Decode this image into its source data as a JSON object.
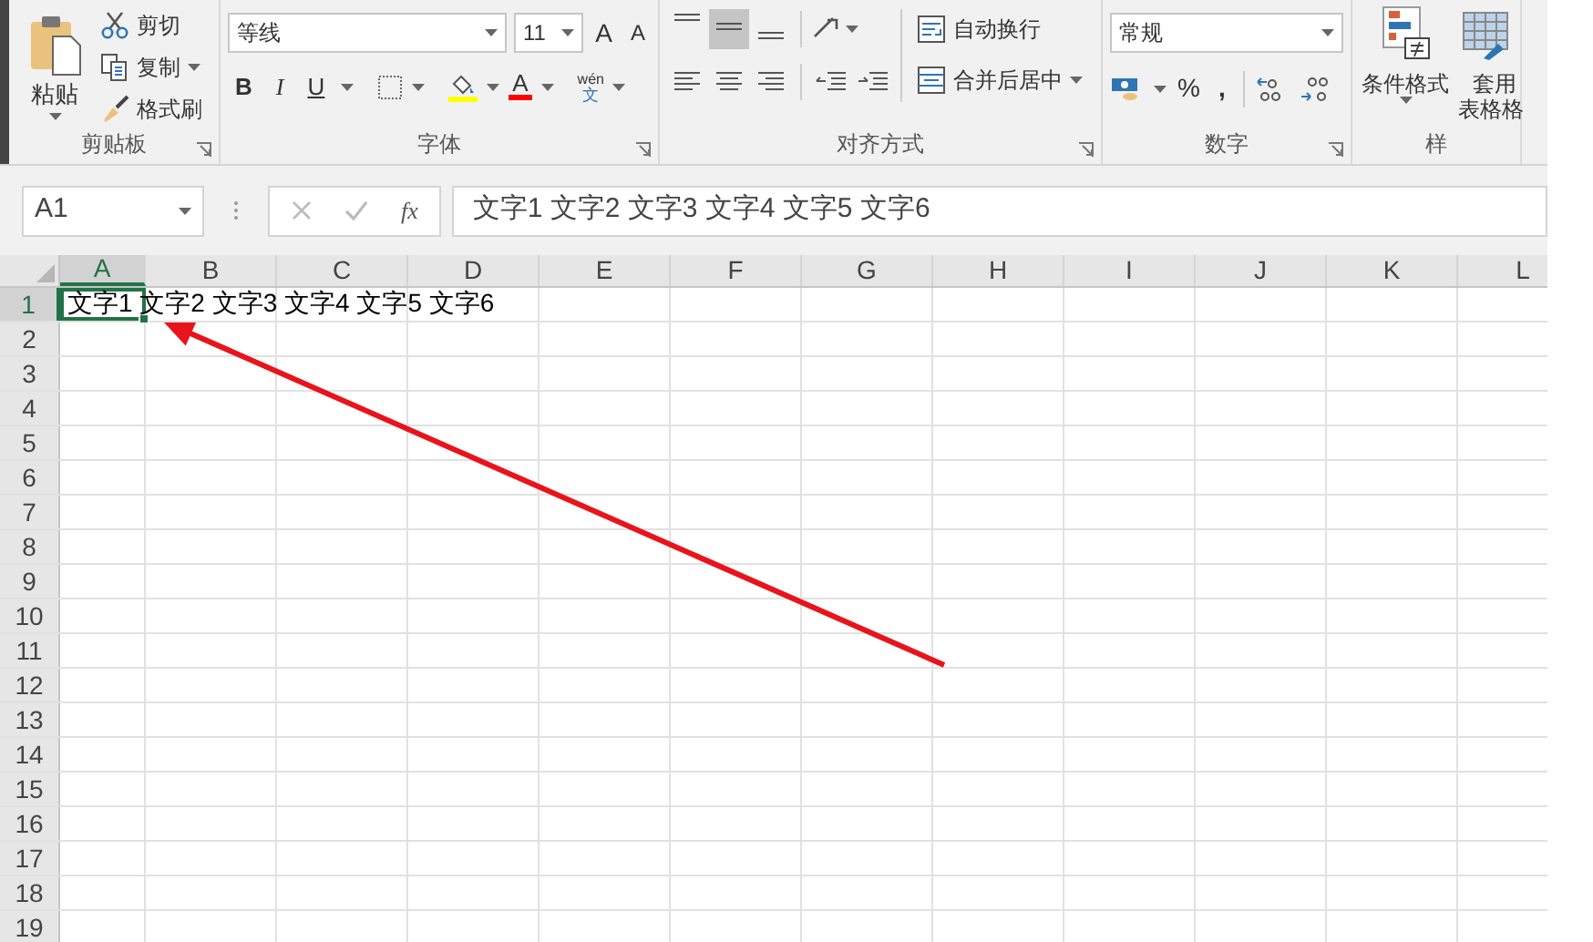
{
  "ribbon": {
    "groups": [
      {
        "kind": "clipboard",
        "label": "剪贴板",
        "paste": "粘贴",
        "cut": "剪切",
        "copy": "复制",
        "format_painter": "格式刷"
      },
      {
        "kind": "font",
        "label": "字体",
        "font_name": "等线",
        "font_size": "11",
        "grow_font": "A",
        "shrink_font": "A",
        "bold": "B",
        "italic": "I",
        "underline": "U",
        "font_color": "A",
        "phonetic_top": "wén",
        "phonetic_bottom": "文"
      },
      {
        "kind": "alignment",
        "label": "对齐方式",
        "wrap_text": "自动换行",
        "merge_center": "合并后居中",
        "vertical_align": [
          {
            "selected": false
          },
          {
            "selected": true
          },
          {
            "selected": false
          }
        ]
      },
      {
        "kind": "number",
        "label": "数字",
        "format": "常规",
        "percent": "%",
        "comma": ","
      },
      {
        "kind": "styles",
        "label": "样",
        "conditional_format": "条件格式",
        "table_format_line1": "套用",
        "table_format_line2": "表格格"
      }
    ]
  },
  "formula_bar": {
    "name_box": "A1",
    "fx": "fx",
    "formula": "文字1 文字2 文字3 文字4 文字5 文字6"
  },
  "sheet": {
    "columns": [
      {
        "label": "A",
        "selected": true
      },
      {
        "label": "B",
        "selected": false
      },
      {
        "label": "C",
        "selected": false
      },
      {
        "label": "D",
        "selected": false
      },
      {
        "label": "E",
        "selected": false
      },
      {
        "label": "F",
        "selected": false
      },
      {
        "label": "G",
        "selected": false
      },
      {
        "label": "H",
        "selected": false
      },
      {
        "label": "I",
        "selected": false
      },
      {
        "label": "J",
        "selected": false
      },
      {
        "label": "K",
        "selected": false
      },
      {
        "label": "L",
        "selected": false
      }
    ],
    "rows": [
      {
        "label": "1",
        "selected": true,
        "cells": [
          "文字1 文字2 文字3 文字4 文字5 文字6"
        ]
      },
      {
        "label": "2",
        "selected": false
      },
      {
        "label": "3",
        "selected": false
      },
      {
        "label": "4",
        "selected": false
      },
      {
        "label": "5",
        "selected": false
      },
      {
        "label": "6",
        "selected": false
      },
      {
        "label": "7",
        "selected": false
      },
      {
        "label": "8",
        "selected": false
      },
      {
        "label": "9",
        "selected": false
      },
      {
        "label": "10",
        "selected": false
      },
      {
        "label": "11",
        "selected": false
      },
      {
        "label": "12",
        "selected": false
      },
      {
        "label": "13",
        "selected": false
      },
      {
        "label": "14",
        "selected": false
      },
      {
        "label": "15",
        "selected": false
      },
      {
        "label": "16",
        "selected": false
      },
      {
        "label": "17",
        "selected": false
      },
      {
        "label": "18",
        "selected": false
      },
      {
        "label": "19",
        "selected": false
      }
    ]
  }
}
